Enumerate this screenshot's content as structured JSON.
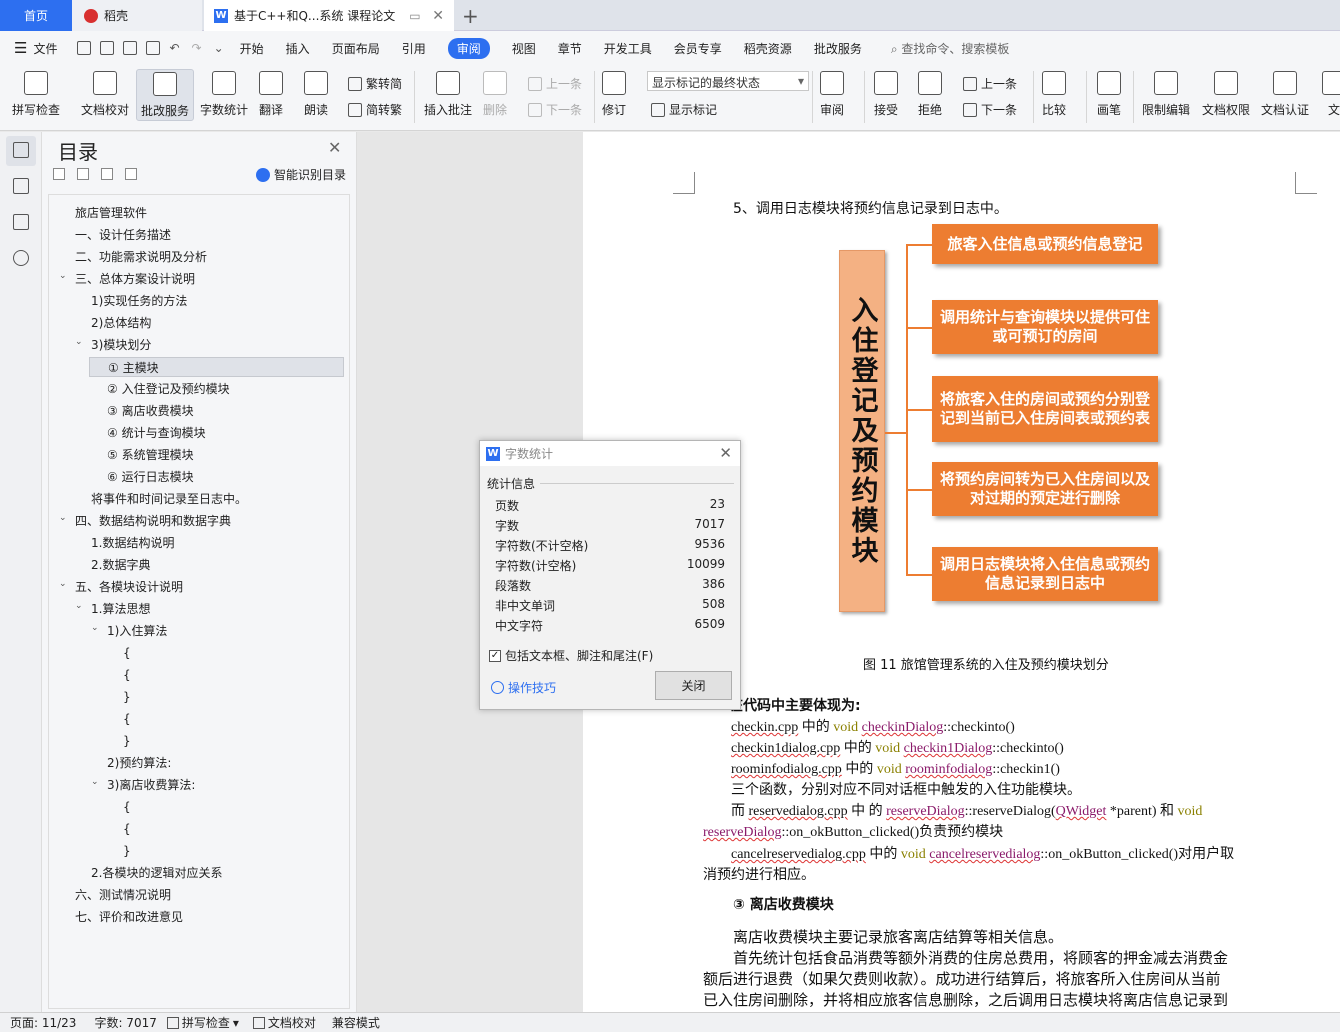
{
  "tabs": {
    "home": "首页",
    "daoke": "稻壳",
    "doc": "基于C++和Q...系统 课程论文"
  },
  "menu": {
    "file": "文件",
    "items": [
      "开始",
      "插入",
      "页面布局",
      "引用",
      "审阅",
      "视图",
      "章节",
      "开发工具",
      "会员专享",
      "稻壳资源",
      "批改服务"
    ],
    "active": "审阅",
    "search": "查找命令、搜索模板"
  },
  "toolbar": {
    "spell": "拼写检查",
    "doccheck": "文档校对",
    "review_service": "批改服务",
    "wordcount": "字数统计",
    "translate": "翻译",
    "read": "朗读",
    "trad": "繁转简",
    "simp": "简转繁",
    "insert_comment": "插入批注",
    "delete": "删除",
    "prev": "上一条",
    "next": "下一条",
    "revise": "修订",
    "markup_select": "显示标记的最终状态",
    "show_markup": "显示标记",
    "review": "审阅",
    "accept": "接受",
    "reject": "拒绝",
    "prev2": "上一条",
    "next2": "下一条",
    "compare": "比较",
    "pen": "画笔",
    "restrict": "限制编辑",
    "perm": "文档权限",
    "cert": "文档认证",
    "more": "文"
  },
  "toc": {
    "title": "目录",
    "smart": "智能识别目录",
    "items": [
      "旅店管理软件",
      "一、设计任务描述",
      "二、功能需求说明及分析",
      "三、总体方案设计说明",
      "1)实现任务的方法",
      "2)总体结构",
      "3)模块划分",
      "① 主模块",
      "② 入住登记及预约模块",
      "③ 离店收费模块",
      "④ 统计与查询模块",
      "⑤ 系统管理模块",
      "⑥ 运行日志模块",
      "将事件和时间记录至日志中。",
      "四、数据结构说明和数据字典",
      "1.数据结构说明",
      "2.数据字典",
      "五、各模块设计说明",
      "1.算法思想",
      "1)入住算法",
      "{",
      "{",
      "}",
      "{",
      "}",
      "2)预约算法:",
      "3)离店收费算法:",
      "{",
      "{",
      "}",
      "2.各模块的逻辑对应关系",
      "六、测试情况说明",
      "七、评价和改进意见"
    ]
  },
  "doc": {
    "line1": "5、调用日志模块将预约信息记录到日志中。",
    "diagram_main": "入住登记及预约模块",
    "diagram_boxes": [
      "旅客入住信息或预约信息登记",
      "调用统计与查询模块以提供可住或可预订的房间",
      "将旅客入住的房间或预约分别登记到当前已入住房间表或预约表",
      "将预约房间转为已入住房间以及对过期的预定进行删除",
      "调用日志模块将入住信息或预约信息记录到日志中"
    ],
    "caption": "图 11 旅馆管理系统的入住及预约模块划分",
    "heading1": "在代码中主要体现为:",
    "c1a": "checkin.cpp",
    "c1b": " 中的 ",
    "c1c": "void",
    "c1d": "checkinDialog",
    "c1e": "::checkinto()",
    "c2a": "checkin1dialog.cpp",
    "c2b": " 中的 ",
    "c2c": "void",
    "c2d": "checkin1Dialog",
    "c2e": "::checkinto()",
    "c3a": "roominfodialog.cpp",
    "c3b": " 中的 ",
    "c3c": "void",
    "c3d": "roominfodialog",
    "c3e": "::checkin1()",
    "c4": "三个函数，分别对应不同对话框中触发的入住功能模块。",
    "c5a": "而 ",
    "c5b": "reservedialog.cpp",
    "c5c": " 中 的 ",
    "c5d": "reserveDialog",
    "c5e": "::reserveDialog(",
    "c5f": "QWidget",
    "c5g": " *parent) 和 ",
    "c5h": "void",
    "c6a": "reserveDialog",
    "c6b": "::on_okButton_clicked()负责预约模块",
    "c7a": "cancelreservedialog.cpp",
    "c7b": " 中的 ",
    "c7c": "void",
    "c7d": "cancelreservedialog",
    "c7e": "::on_okButton_clicked()对用户取",
    "c8": "消预约进行相应。",
    "heading2": "③ 离店收费模块",
    "p1": "离店收费模块主要记录旅客离店结算等相关信息。",
    "p2": "首先统计包括食品消费等额外消费的住房总费用，将顾客的押金减去消费金",
    "p3": "额后进行退费（如果欠费则收款）。成功进行结算后，将旅客所入住房间从当前",
    "p4": "已入住房间删除，并将相应旅客信息删除，之后调用日志模块将离店信息记录到"
  },
  "dialog": {
    "title": "字数统计",
    "section": "统计信息",
    "rows": [
      [
        "页数",
        "23"
      ],
      [
        "字数",
        "7017"
      ],
      [
        "字符数(不计空格)",
        "9536"
      ],
      [
        "字符数(计空格)",
        "10099"
      ],
      [
        "段落数",
        "386"
      ],
      [
        "非中文单词",
        "508"
      ],
      [
        "中文字符",
        "6509"
      ]
    ],
    "checkbox": "包括文本框、脚注和尾注(F)",
    "tips": "操作技巧",
    "close": "关闭"
  },
  "status": {
    "page": "页面: 11/23",
    "words": "字数: 7017",
    "spell": "拼写检查",
    "doccheck": "文档校对",
    "compat": "兼容模式"
  }
}
